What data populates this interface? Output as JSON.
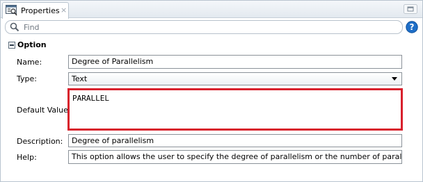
{
  "tab": {
    "label": "Properties",
    "close": "×",
    "icon": "properties-icon"
  },
  "search": {
    "placeholder": "Find",
    "icon": "search-icon"
  },
  "help": {
    "icon": "help-icon"
  },
  "section": {
    "title": "Option",
    "collapse_icon": "collapse-icon"
  },
  "fields": {
    "name": {
      "label": "Name:",
      "value": "Degree of Parallelism"
    },
    "type": {
      "label": "Type:",
      "value": "Text"
    },
    "default_value": {
      "label": "Default Value:",
      "value": "PARALLEL"
    },
    "description": {
      "label": "Description:",
      "value": "Degree of parallelism"
    },
    "help": {
      "label": "Help:",
      "value": "This option allows the user to specify the degree of parallelism or the number of parallel"
    }
  },
  "colors": {
    "highlight": "#d8202c",
    "help_blue": "#1f6fc8"
  }
}
